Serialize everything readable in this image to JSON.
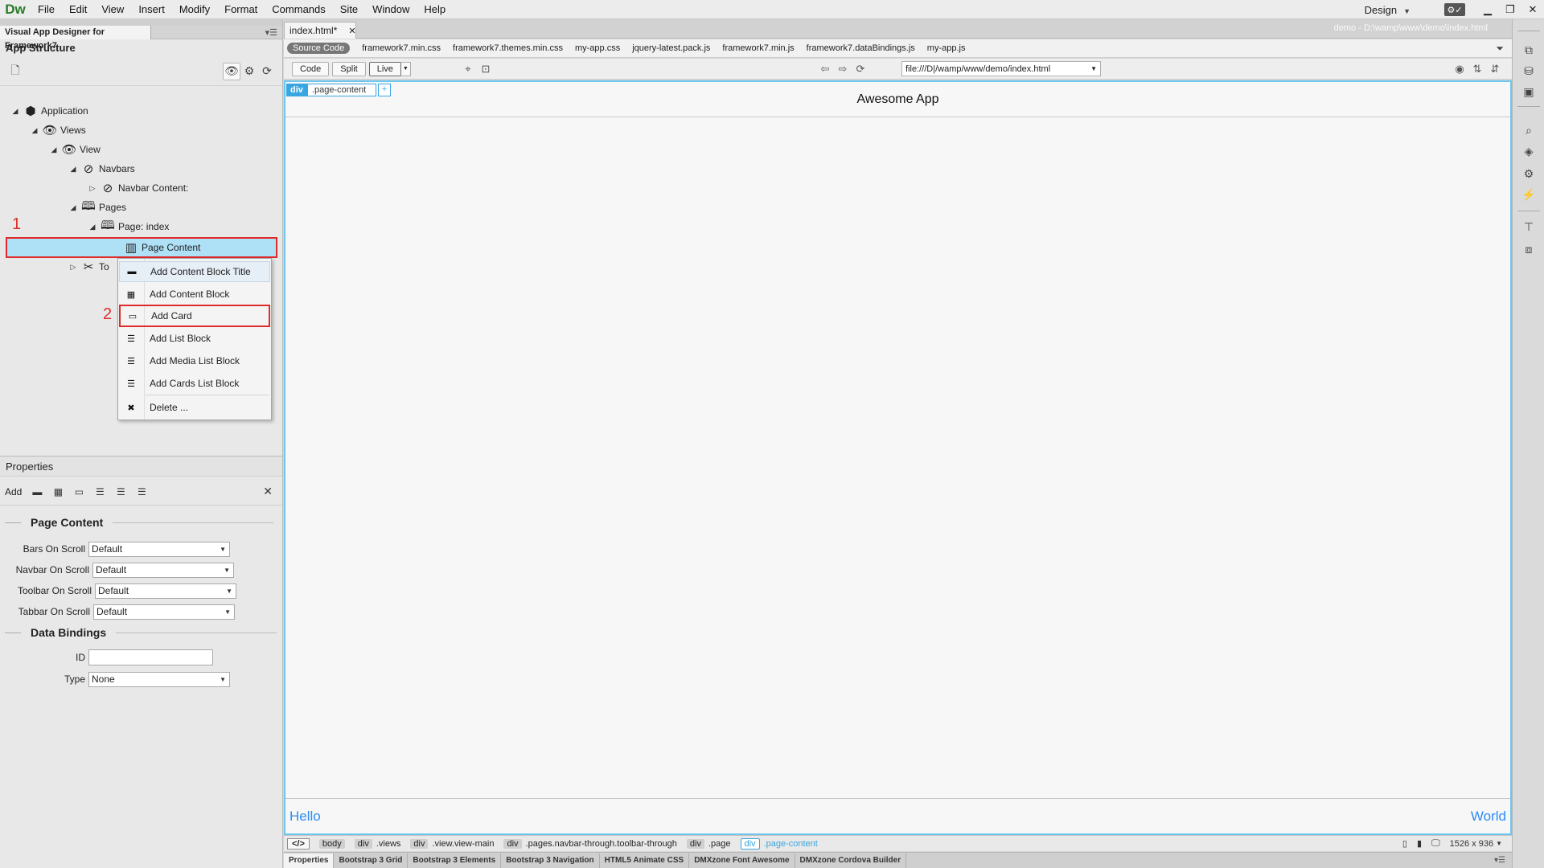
{
  "app": {
    "logo": "Dw"
  },
  "menubar": {
    "items": [
      "File",
      "Edit",
      "View",
      "Insert",
      "Modify",
      "Format",
      "Commands",
      "Site",
      "Window",
      "Help"
    ],
    "workspace": "Design"
  },
  "left_panel": {
    "panel_tab": "Visual App Designer for Framework7",
    "section_title": "App Structure",
    "tree": [
      {
        "label": "Application",
        "icon": "cube-icon"
      },
      {
        "label": "Views",
        "icon": "eye-icon"
      },
      {
        "label": "View",
        "icon": "eye-icon"
      },
      {
        "label": "Navbars",
        "icon": "compass-icon"
      },
      {
        "label": "Navbar Content:",
        "icon": "compass-icon"
      },
      {
        "label": "Pages",
        "icon": "book-icon"
      },
      {
        "label": "Page: index",
        "icon": "book-icon"
      },
      {
        "label": "Page Content",
        "icon": "page-content-icon"
      },
      {
        "label": "To",
        "icon": "tools-icon"
      }
    ],
    "markers": [
      "1",
      "2"
    ],
    "context_menu": [
      {
        "label": "Add Content Block Title",
        "icon": "minus-icon"
      },
      {
        "label": "Add Content Block",
        "icon": "grid-icon"
      },
      {
        "label": "Add Card",
        "icon": "card-icon"
      },
      {
        "label": "Add List Block",
        "icon": "list-icon"
      },
      {
        "label": "Add Media List Block",
        "icon": "list-icon"
      },
      {
        "label": "Add Cards List Block",
        "icon": "list-icon"
      },
      {
        "label": "Delete ...",
        "icon": "close-icon"
      }
    ]
  },
  "properties": {
    "title": "Properties",
    "add_label": "Add",
    "group1_title": "Page Content",
    "rows": [
      {
        "label": "Bars On Scroll",
        "value": "Default"
      },
      {
        "label": "Navbar On Scroll",
        "value": "Default"
      },
      {
        "label": "Toolbar On Scroll",
        "value": "Default"
      },
      {
        "label": "Tabbar On Scroll",
        "value": "Default"
      }
    ],
    "group2_title": "Data Bindings",
    "id_label": "ID",
    "id_value": "",
    "type_label": "Type",
    "type_value": "None"
  },
  "document": {
    "tab": "index.html*",
    "path": "demo - D:\\wamp\\www\\demo\\index.html",
    "related_files": [
      "Source Code",
      "framework7.min.css",
      "framework7.themes.min.css",
      "my-app.css",
      "jquery-latest.pack.js",
      "framework7.min.js",
      "framework7.dataBindings.js",
      "my-app.js"
    ],
    "view_buttons": [
      "Code",
      "Split",
      "Live"
    ],
    "url": "file:///D|/wamp/www/demo/index.html"
  },
  "canvas": {
    "chip_tag": "div",
    "chip_class": ".page-content",
    "chip_plus": "+",
    "navbar_title": "Awesome App",
    "toolbar_left": "Hello",
    "toolbar_right": "World"
  },
  "tag_selector": {
    "code": "</>",
    "items": [
      {
        "tag": "body",
        "cls": ""
      },
      {
        "tag": "div",
        "cls": ".views"
      },
      {
        "tag": "div",
        "cls": ".view.view-main"
      },
      {
        "tag": "div",
        "cls": ".pages.navbar-through.toolbar-through"
      },
      {
        "tag": "div",
        "cls": ".page"
      },
      {
        "tag": "div",
        "cls": ".page-content"
      }
    ],
    "size": "1526 x 936"
  },
  "bottom_tabs": [
    "Properties",
    "Bootstrap 3 Grid",
    "Bootstrap 3 Elements",
    "Bootstrap 3 Navigation",
    "HTML5 Animate CSS",
    "DMXzone Font Awesome",
    "DMXzone Cordova Builder"
  ],
  "colors": {
    "accent": "#38a6e2",
    "highlight": "#aee0f6",
    "annotation": "#e02b2b",
    "link": "#2c8cf4"
  }
}
